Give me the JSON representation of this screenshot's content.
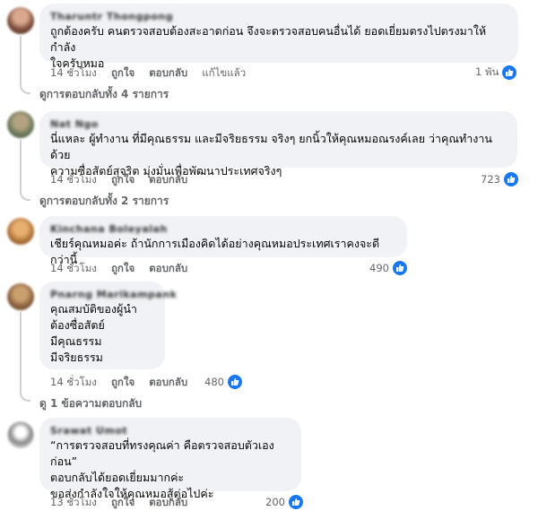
{
  "comments": [
    {
      "author": "Tharuntr Thongpong",
      "text": "ถูกต้องครับ คนตรวจสอบต้องสะอาดก่อน จึงจะตรวจสอบคนอื่นได้ ยอดเยี่ยมตรงไปตรงมาให้กำลัง\nใจครับหมอ",
      "time": "14 ชั่วโมง",
      "like": "ถูกใจ",
      "reply": "ตอบกลับ",
      "edited": "แก้ไขแล้ว",
      "reactions": "1 พัน",
      "replies": "ดูการตอบกลับทั้ง 4 รายการ"
    },
    {
      "author": "Nat Ngo",
      "text": "นี่แหละ ผู้ทำงาน ที่มีคุณธรรม และมีจริยธรรม จริงๆ ยกนิ้วให้คุณหมอณรงค์เลย ว่าคุณทำงานด้วย\nความซื่อสัตย์สุจริต มุ่งมั่นเพื่อพัฒนาประเทศจริงๆ",
      "time": "14 ชั่วโมง",
      "like": "ถูกใจ",
      "reply": "ตอบกลับ",
      "reactions": "723",
      "replies": "ดูการตอบกลับทั้ง 2 รายการ"
    },
    {
      "author": "Kinchana Boleyalah",
      "text": "เชียร์คุณหมอค่ะ ถ้านักการเมืองคิดได้อย่างคุณหมอประเทศเราคงจะดีกว่านี้",
      "time": "14 ชั่วโมง",
      "like": "ถูกใจ",
      "reply": "ตอบกลับ",
      "reactions": "490"
    },
    {
      "author": "Pnarng Marikampank",
      "text": "คุณสมบัติของผู้นำ\nต้องซื่อสัตย์\nมีคุณธรรม\nมีจริยธรรม",
      "time": "14 ชั่วโมง",
      "like": "ถูกใจ",
      "reply": "ตอบกลับ",
      "reactions": "480",
      "replies": "ดู 1 ข้อความตอบกลับ"
    },
    {
      "author": "Srawat Umot",
      "text": "“การตรวจสอบที่ทรงคุณค่า คือตรวจสอบตัวเองก่อน”\nตอบกลับได้ยอดเยี่ยมมากค่ะ\nขอส่งกำลังใจให้คุณหมอสู้ต่อไปค่ะ",
      "time": "13 ชั่วโมง",
      "like": "ถูกใจ",
      "reply": "ตอบกลับ",
      "reactions": "200"
    }
  ],
  "colors": {
    "bubble": "#f0f2f5",
    "meta": "#65676b",
    "like_blue": "#1877f2"
  },
  "icons": {
    "reaction": "like-thumb-icon"
  }
}
